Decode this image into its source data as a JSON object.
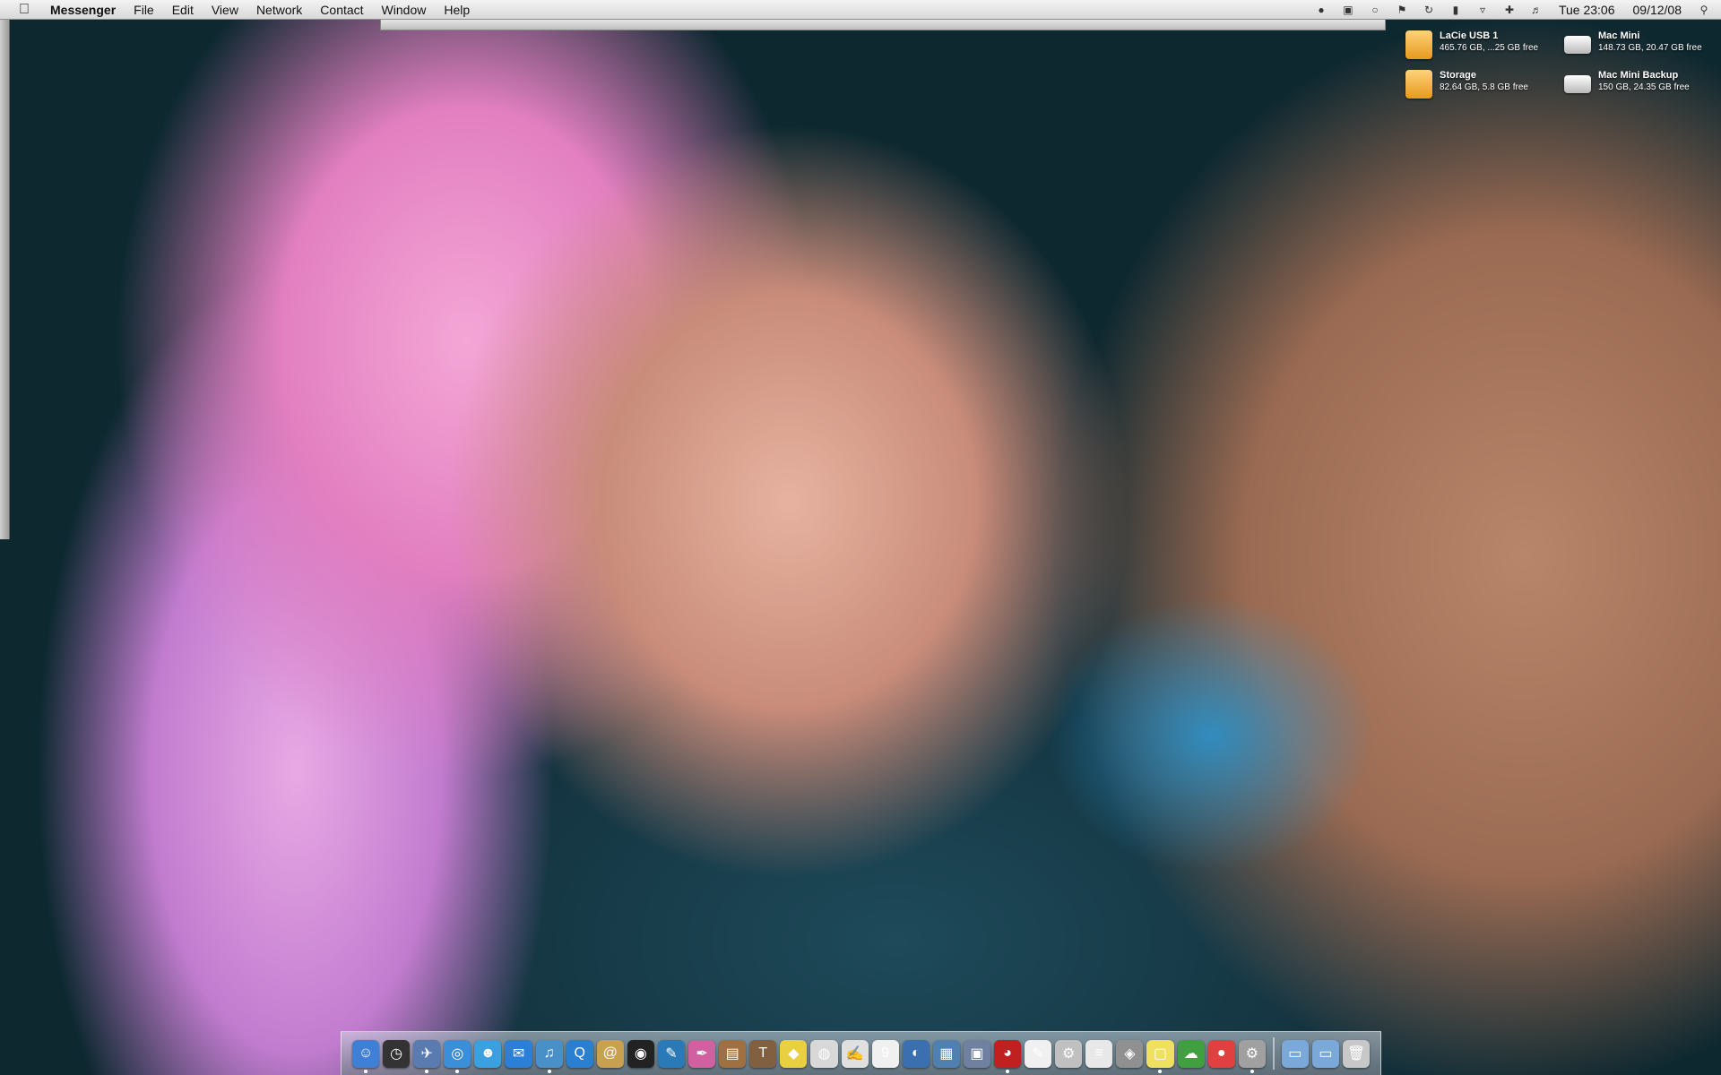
{
  "menubar": {
    "app_name": "Messenger",
    "items": [
      "File",
      "Edit",
      "View",
      "Network",
      "Contact",
      "Window",
      "Help"
    ],
    "clock": "Tue 23:06",
    "date": "09/12/08",
    "status_icons": [
      "messenger-status-icon",
      "time-machine-icon",
      "circle-status-icon",
      "flag-icon",
      "sync-icon",
      "battery-icon",
      "wifi-icon",
      "uk-flag-icon",
      "volume-icon",
      "spotlight-icon"
    ]
  },
  "drives": [
    {
      "name": "LaCie USB 1",
      "info": "465.76 GB, ...25 GB free",
      "icon": "orange-drive-icon"
    },
    {
      "name": "Mac Mini",
      "info": "148.73 GB, 20.47 GB free",
      "icon": "internal-drive-icon"
    },
    {
      "name": "Storage",
      "info": "82.64 GB, 5.8 GB free",
      "icon": "orange-drive-icon"
    },
    {
      "name": "Mac Mini Backup",
      "info": "150 GB, 24.35 GB free",
      "icon": "internal-drive-icon"
    }
  ],
  "dock": {
    "apps": [
      {
        "name": "finder-icon",
        "color": "#3f7fd6",
        "glyph": "☺",
        "running": true
      },
      {
        "name": "dashboard-icon",
        "color": "#333333",
        "glyph": "◷",
        "running": false
      },
      {
        "name": "mail-stamp-icon",
        "color": "#5a7bb0",
        "glyph": "✈",
        "running": true
      },
      {
        "name": "safari-icon",
        "color": "#3b8fd8",
        "glyph": "◎",
        "running": true
      },
      {
        "name": "messenger-buddies-icon",
        "color": "#3aa0e0",
        "glyph": "☻",
        "running": false
      },
      {
        "name": "ichat-icon",
        "color": "#2c7fd6",
        "glyph": "✉",
        "running": false
      },
      {
        "name": "itunes-icon",
        "color": "#4a90c8",
        "glyph": "♫",
        "running": true
      },
      {
        "name": "quicktime-icon",
        "color": "#2b7fd0",
        "glyph": "Q",
        "running": false
      },
      {
        "name": "address-book-icon",
        "color": "#c8a050",
        "glyph": "@",
        "running": false
      },
      {
        "name": "aperture-icon",
        "color": "#222222",
        "glyph": "◉",
        "running": false
      },
      {
        "name": "feather-icon",
        "color": "#2b7ab8",
        "glyph": "✎",
        "running": false
      },
      {
        "name": "quill-icon",
        "color": "#d060a0",
        "glyph": "✒",
        "running": false
      },
      {
        "name": "books-icon",
        "color": "#a07040",
        "glyph": "▤",
        "running": false
      },
      {
        "name": "latex-icon",
        "color": "#806040",
        "glyph": "T",
        "running": false
      },
      {
        "name": "stickies-diamond-icon",
        "color": "#e8d040",
        "glyph": "◆",
        "running": false
      },
      {
        "name": "mouse-icon",
        "color": "#d8d8d8",
        "glyph": "◍",
        "running": false
      },
      {
        "name": "notepad-icon",
        "color": "#e0e0e0",
        "glyph": "✍",
        "running": false
      },
      {
        "name": "ical-icon",
        "color": "#f0f0f0",
        "glyph": "9",
        "running": false
      },
      {
        "name": "preview-icon",
        "color": "#3a6fb0",
        "glyph": "◐",
        "running": false
      },
      {
        "name": "iphoto-icon",
        "color": "#5080b0",
        "glyph": "▦",
        "running": false
      },
      {
        "name": "truck-icon",
        "color": "#7080a0",
        "glyph": "▣",
        "running": false
      },
      {
        "name": "dvd-icon",
        "color": "#c02020",
        "glyph": "◕",
        "running": true
      },
      {
        "name": "textedit-icon",
        "color": "#f0f0f0",
        "glyph": "✎",
        "running": false
      },
      {
        "name": "script-icon",
        "color": "#c0c0c0",
        "glyph": "⚙",
        "running": false
      },
      {
        "name": "document-icon",
        "color": "#e8e8e8",
        "glyph": "≡",
        "running": false
      },
      {
        "name": "disk-utility-icon",
        "color": "#909090",
        "glyph": "◈",
        "running": false
      },
      {
        "name": "stickies-icon",
        "color": "#f0e060",
        "glyph": "▢",
        "running": true
      },
      {
        "name": "network-icon",
        "color": "#40a040",
        "glyph": "☁",
        "running": false
      },
      {
        "name": "color-wheel-icon",
        "color": "#e04040",
        "glyph": "●",
        "running": false
      },
      {
        "name": "system-preferences-icon",
        "color": "#a0a0a0",
        "glyph": "⚙",
        "running": true
      }
    ],
    "stacks": [
      {
        "name": "applications-folder-icon",
        "color": "#7aa8d8",
        "glyph": "▭"
      },
      {
        "name": "documents-folder-icon",
        "color": "#7aa8d8",
        "glyph": "▭"
      },
      {
        "name": "trash-icon",
        "color": "#c8c8c8",
        "glyph": "🗑"
      }
    ]
  }
}
